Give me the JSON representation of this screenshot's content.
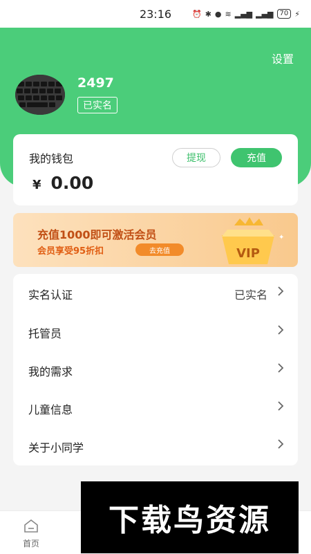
{
  "status_bar": {
    "time": "23:16",
    "battery": "70"
  },
  "header": {
    "settings_label": "设置"
  },
  "profile": {
    "username": "2497",
    "verified_tag": "已实名"
  },
  "wallet": {
    "title": "我的钱包",
    "currency_symbol": "¥",
    "balance": "0.00",
    "withdraw_label": "提现",
    "recharge_label": "充值"
  },
  "vip_banner": {
    "title": "充值1000即可激活会员",
    "subtitle": "会员享受95折扣",
    "button_label": "去充值",
    "badge_text": "VIP"
  },
  "menu": {
    "items": [
      {
        "label": "实名认证",
        "value": "已实名"
      },
      {
        "label": "托管员",
        "value": ""
      },
      {
        "label": "我的需求",
        "value": ""
      },
      {
        "label": "儿童信息",
        "value": ""
      },
      {
        "label": "关于小同学",
        "value": ""
      }
    ]
  },
  "tabbar": {
    "home_label": "首页"
  },
  "watermark": {
    "text": "下载鸟资源"
  },
  "colors": {
    "brand_green": "#4bcd7a",
    "vip_orange": "#f28b2a"
  }
}
